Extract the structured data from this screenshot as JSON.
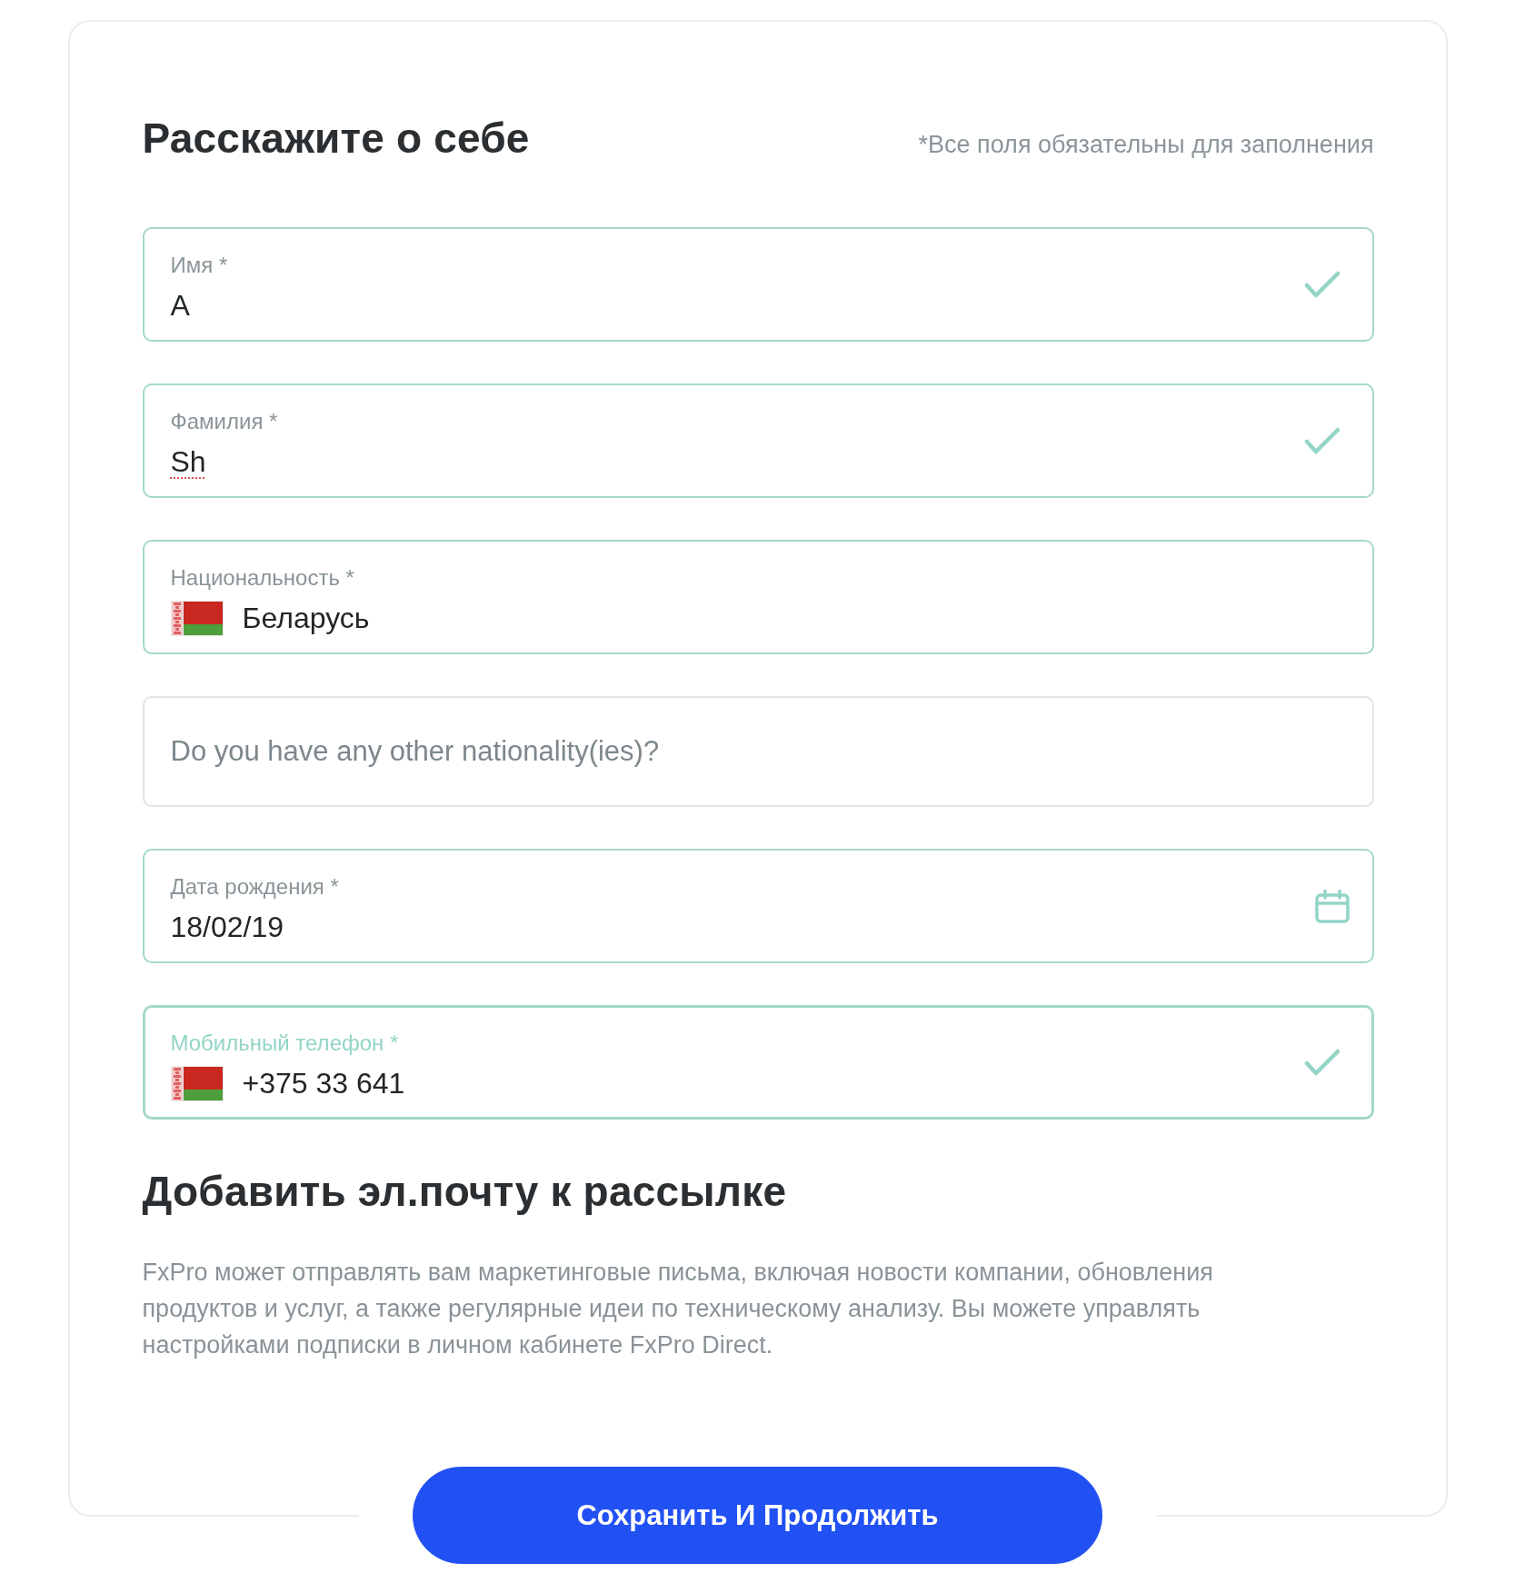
{
  "header": {
    "title": "Расскажите о себе",
    "note": "*Все поля обязательны для заполнения"
  },
  "fields": [
    {
      "kind": "text",
      "label": "Имя *",
      "value": "A",
      "valid": true,
      "focused": false
    },
    {
      "kind": "text",
      "label": "Фамилия *",
      "value": "Sh",
      "valid": true,
      "focused": false,
      "spellcheck_error": true
    },
    {
      "kind": "country",
      "label": "Национальность *",
      "value": "Беларусь",
      "valid": false,
      "focused": false
    },
    {
      "kind": "text",
      "placeholder": "Do you have any other nationality(ies)?",
      "valid": false,
      "focused": false
    },
    {
      "kind": "date",
      "label": "Дата рождения *",
      "value": "18/02/19",
      "valid": false,
      "focused": false
    },
    {
      "kind": "phone",
      "label": "Мобильный телефон *",
      "value": "+375 33 641",
      "valid": true,
      "focused": true
    }
  ],
  "newsletter": {
    "title": "Добавить эл.почту к рассылке",
    "text": "FxPro может отправлять вам маркетинговые письма, включая новости компании, обновления продуктов и услуг, а также регулярные идеи по техническому анализу. Вы можете управлять настройками подписки в личном кабинете FxPro Direct."
  },
  "submit_button": {
    "label": "Сохранить И Продолжить"
  }
}
